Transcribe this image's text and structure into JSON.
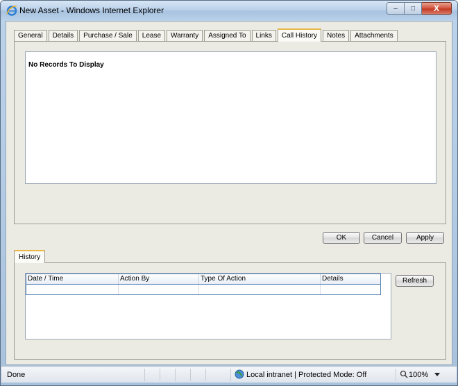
{
  "window": {
    "title": "New Asset - Windows Internet Explorer",
    "close_glyph": "X",
    "min_glyph": "–",
    "max_glyph": "□"
  },
  "tabs": [
    {
      "label": "General",
      "active": false
    },
    {
      "label": "Details",
      "active": false
    },
    {
      "label": "Purchase / Sale",
      "active": false
    },
    {
      "label": "Lease",
      "active": false
    },
    {
      "label": "Warranty",
      "active": false
    },
    {
      "label": "Assigned To",
      "active": false
    },
    {
      "label": "Links",
      "active": false
    },
    {
      "label": "Call History",
      "active": true
    },
    {
      "label": "Notes",
      "active": false
    },
    {
      "label": "Attachments",
      "active": false
    }
  ],
  "records": {
    "empty_message": "No Records To Display"
  },
  "buttons": {
    "ok": "OK",
    "cancel": "Cancel",
    "apply": "Apply",
    "refresh": "Refresh"
  },
  "history": {
    "tab_label": "History",
    "columns": [
      "Date / Time",
      "Action By",
      "Type Of Action",
      "Details"
    ]
  },
  "statusbar": {
    "status": "Done",
    "zone": "Local intranet | Protected Mode: Off",
    "zoom": "100%"
  }
}
